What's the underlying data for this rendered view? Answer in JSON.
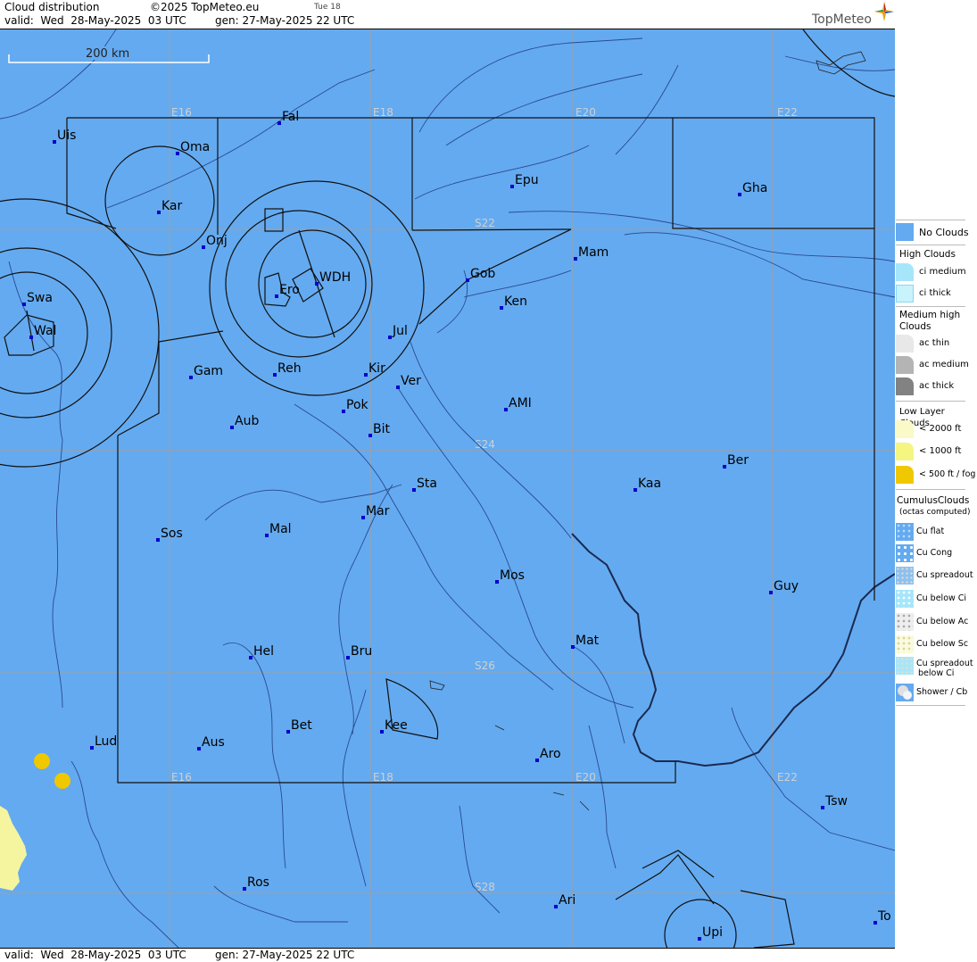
{
  "header": {
    "title": "Cloud distribution",
    "copyright": "©2025 TopMeteo.eu",
    "run_label": "Tue 18",
    "valid": "valid:  Wed  28-May-2025  03 UTC",
    "generated": "gen: 27-May-2025 22 UTC",
    "logo": "TopMeteo"
  },
  "footer": {
    "valid": "valid:  Wed  28-May-2025  03 UTC",
    "generated": "gen: 27-May-2025 22 UTC"
  },
  "map": {
    "scale_label": "200 km",
    "background_color": "#64aaf0",
    "grid_labels": [
      "E16",
      "E18",
      "E20",
      "E22",
      "S22",
      "S24",
      "S26",
      "S28"
    ],
    "places": [
      "Uis",
      "Fal",
      "Oma",
      "Kar",
      "Onj",
      "Epu",
      "Gha",
      "Mam",
      "Swa",
      "WDH",
      "Ero",
      "Gob",
      "Ken",
      "Wal",
      "Jul",
      "Gam",
      "Reh",
      "Kir",
      "Ver",
      "AMI",
      "Pok",
      "Aub",
      "Bit",
      "Ber",
      "Kaa",
      "Sta",
      "Mar",
      "Sos",
      "Mal",
      "Mos",
      "Guy",
      "Mat",
      "Hel",
      "Bru",
      "Kee",
      "Bet",
      "Lud",
      "Aus",
      "Aro",
      "Tsw",
      "Ros",
      "Ari",
      "Upi",
      "To"
    ]
  },
  "legend": {
    "colors": {
      "no_clouds": "#64aaf0",
      "ci_medium": "#a6e6fa",
      "ci_thick": "#c8f2fc",
      "ac_thin": "#e8e8e8",
      "ac_medium": "#b4b4b4",
      "ac_thick": "#828282",
      "low_2000": "#fafac8",
      "low_1000": "#f5f582",
      "low_500": "#f0c800",
      "fog_spots": "#f0c800",
      "cloud_west": "#f5f5a0"
    },
    "no_clouds": "No Clouds",
    "high_clouds_head": "High Clouds",
    "ci_medium": "ci medium",
    "ci_thick": "ci thick",
    "medium_head": "Medium high Clouds",
    "ac_thin": "ac thin",
    "ac_medium": "ac medium",
    "ac_thick": "ac thick",
    "low_head": "Low Layer Clouds",
    "low_2000": "< 2000 ft",
    "low_1000": "< 1000 ft",
    "low_500": "< 500 ft / fog",
    "cumulus_head": "CumulusClouds",
    "cumulus_sub": "(octas computed)",
    "cu_flat": "Cu flat",
    "cu_cong": "Cu Cong",
    "cu_spreadout": "Cu spreadout",
    "cu_below_ci": "Cu below Ci",
    "cu_below_ac": "Cu below Ac",
    "cu_below_sc": "Cu below Sc",
    "cu_spreadout_below_ci_1": "Cu spreadout",
    "cu_spreadout_below_ci_2": "below Ci",
    "shower_cb": "Shower / Cb"
  }
}
